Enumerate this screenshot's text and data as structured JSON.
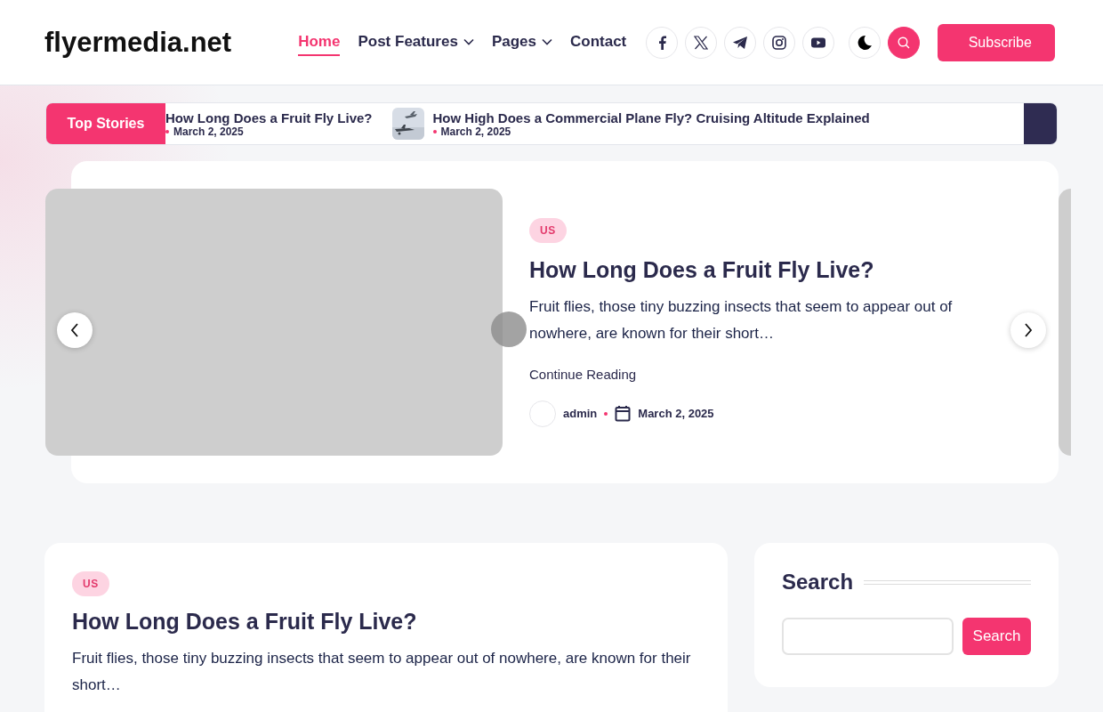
{
  "site": {
    "logo": "flyermedia.net"
  },
  "nav": [
    {
      "label": "Home",
      "selected": true,
      "dropdown": false
    },
    {
      "label": "Post Features",
      "selected": false,
      "dropdown": true
    },
    {
      "label": "Pages",
      "selected": false,
      "dropdown": true
    },
    {
      "label": "Contact",
      "selected": false,
      "dropdown": false
    }
  ],
  "social": [
    {
      "kind": "facebook"
    },
    {
      "kind": "x"
    },
    {
      "kind": "telegram"
    },
    {
      "kind": "instagram"
    },
    {
      "kind": "youtube"
    }
  ],
  "subscribe": "Subscribe",
  "ticker": {
    "label": "Top Stories",
    "items": [
      {
        "title": "How Long Does a Fruit Fly Live?",
        "date": "March 2, 2025",
        "thumb": false
      },
      {
        "title": "How High Does a Commercial Plane Fly? Cruising Altitude Explained",
        "date": "March 2, 2025",
        "thumb": true
      }
    ]
  },
  "slider": {
    "category": "US",
    "title": "How Long Does a Fruit Fly Live?",
    "excerpt": "Fruit flies, those tiny buzzing insects that seem to appear out of nowhere, are known for their short…",
    "link": "Continue Reading",
    "author": "admin",
    "date": "March 2, 2025"
  },
  "post": {
    "category": "US",
    "title": "How Long Does a Fruit Fly Live?",
    "excerpt": "Fruit flies, those tiny buzzing insects that seem to appear out of nowhere, are known for their short…"
  },
  "sidebar": {
    "title": "Search",
    "button": "Search"
  }
}
